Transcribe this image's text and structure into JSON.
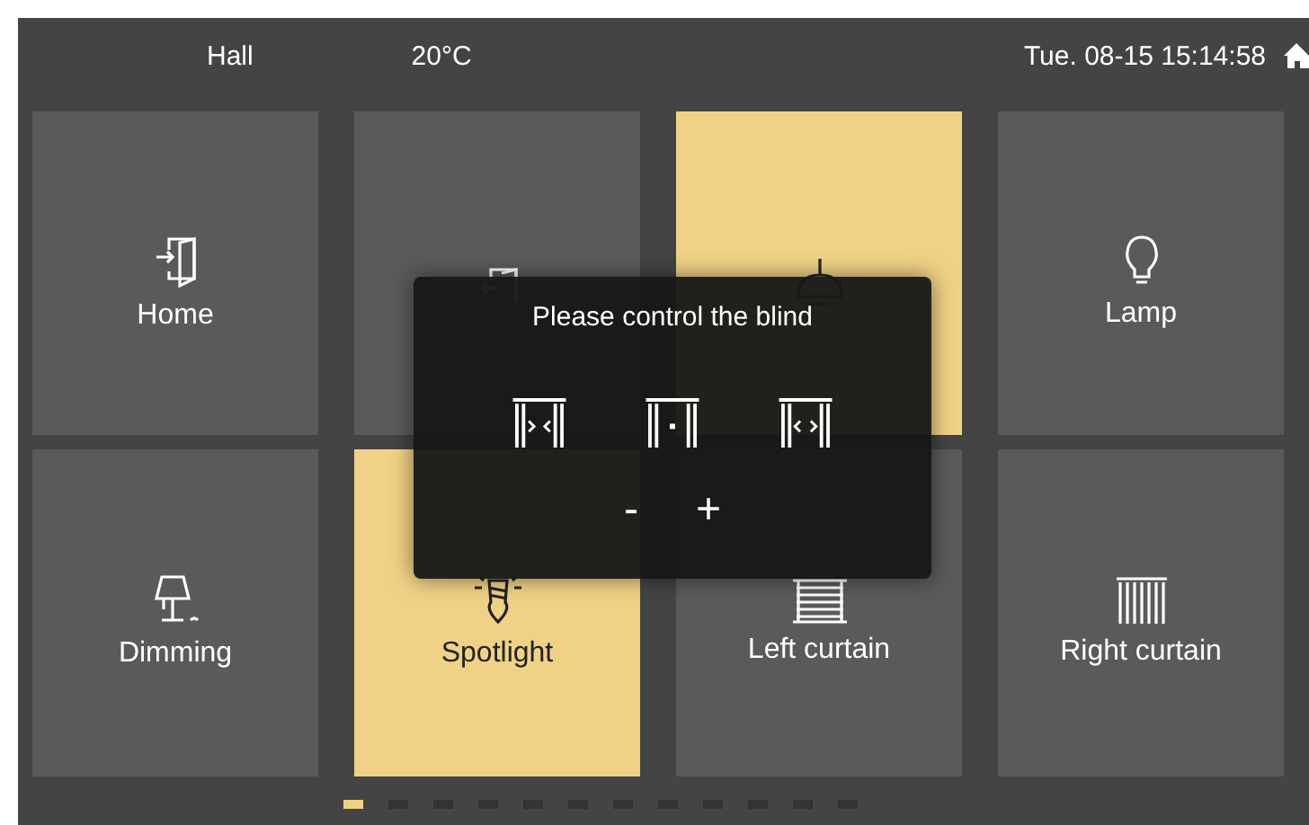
{
  "status_bar": {
    "room": "Hall",
    "temperature": "20°C",
    "datetime": "Tue. 08-15 15:14:58"
  },
  "tiles": [
    {
      "kind": "enter",
      "label": "Home",
      "selected": false
    },
    {
      "kind": "leave",
      "selected": false
    },
    {
      "kind": "chandelier",
      "selected": true
    },
    {
      "kind": "lamp",
      "label": "Lamp",
      "selected": false
    },
    {
      "kind": "dimming",
      "label": "Dimming",
      "selected": false
    },
    {
      "kind": "spotlight",
      "label": "Spotlight",
      "selected": true
    },
    {
      "kind": "blind",
      "label": "Left curtain",
      "selected": false
    },
    {
      "kind": "vertical",
      "label": "Right curtain",
      "selected": false
    }
  ],
  "pages": [
    {
      "selected": true
    },
    {
      "selected": false
    },
    {
      "selected": false
    },
    {
      "selected": false
    },
    {
      "selected": false
    },
    {
      "selected": false
    },
    {
      "selected": false
    },
    {
      "selected": false
    },
    {
      "selected": false
    },
    {
      "selected": false
    },
    {
      "selected": false
    },
    {
      "selected": false
    }
  ],
  "dialog": {
    "title": "Please control the blind",
    "actions": [
      {
        "kind": "close"
      },
      {
        "kind": "stop"
      },
      {
        "kind": "open"
      }
    ],
    "steps": [
      "-",
      "+"
    ]
  }
}
